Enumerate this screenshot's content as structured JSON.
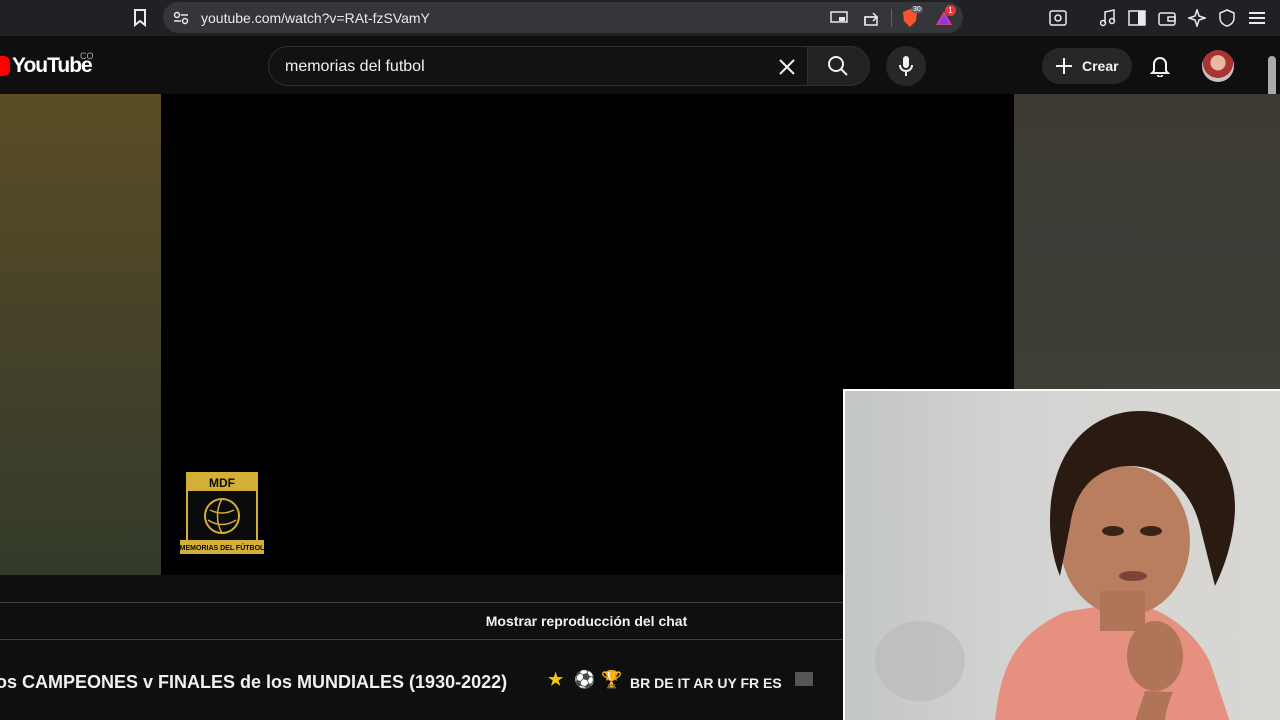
{
  "browser": {
    "url": "youtube.com/watch?v=RAt-fzSVamY",
    "brave_shield_count": "30",
    "rewards_badge": "1"
  },
  "header": {
    "logo_text": "YouTube",
    "country_code": "CO",
    "search_value": "memorias del futbol",
    "create_label": "Crear"
  },
  "video": {
    "watermark_top": "MDF",
    "watermark_bottom": "MEMORIAS DEL FÚTBOL"
  },
  "chat": {
    "replay_label": "Mostrar reproducción del chat"
  },
  "title": {
    "main": "os CAMPEONES v FINALES de los MUNDIALES (1930-2022)",
    "emoji_1": "★",
    "emoji_2": "⚽",
    "emoji_3": "🏆",
    "country_codes": "BR DE IT AR UY FR ES"
  },
  "colors": {
    "brand_red": "#ff0000",
    "background": "#0f0f0f",
    "mdf_gold": "#d4af37"
  },
  "icons": [
    "bookmark-icon",
    "site-settings-icon",
    "cast-icon",
    "share-icon",
    "brave-shield-icon",
    "brave-rewards-icon",
    "screenshot-icon",
    "media-icon",
    "sidebar-icon",
    "wallet-icon",
    "leo-ai-icon",
    "vpn-icon",
    "menu-icon",
    "clear-icon",
    "search-icon",
    "mic-icon",
    "plus-icon",
    "bell-icon"
  ]
}
